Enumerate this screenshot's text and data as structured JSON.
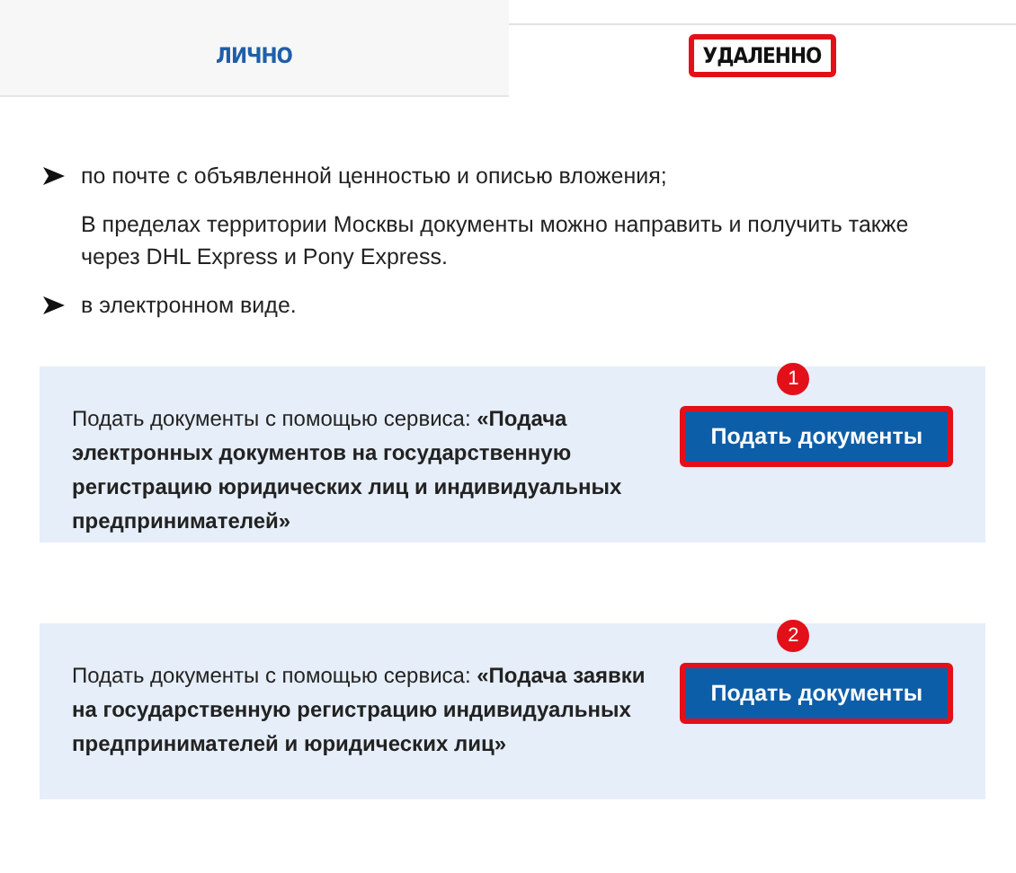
{
  "tabs": [
    {
      "label": "ЛИЧНО",
      "selected": false,
      "highlighted": false
    },
    {
      "label": "УДАЛЕННО",
      "selected": true,
      "highlighted": true
    }
  ],
  "content": [
    {
      "kind": "bullet",
      "text": "по почте с объявленной ценностью и описью вложения;"
    },
    {
      "kind": "note",
      "text": "В пределах территории Москвы документы можно направить и получить также через DHL Express и Pony Express."
    },
    {
      "kind": "bullet",
      "text": "в электронном виде."
    }
  ],
  "services": [
    {
      "text": "Подать документы с помощью сервиса: **«Подача электронных документов на государственную регистрацию юридических лиц и индивидуальных предпринимателей»**",
      "button": "Подать документы",
      "badge": "1",
      "highlighted": true
    },
    {
      "text": "Подать документы с помощью сервиса: **«Подача заявки на государственную регистрацию индивидуальных предпринимателей и юридических лиц»**",
      "button": "Подать документы",
      "badge": "2",
      "highlighted": true
    }
  ]
}
